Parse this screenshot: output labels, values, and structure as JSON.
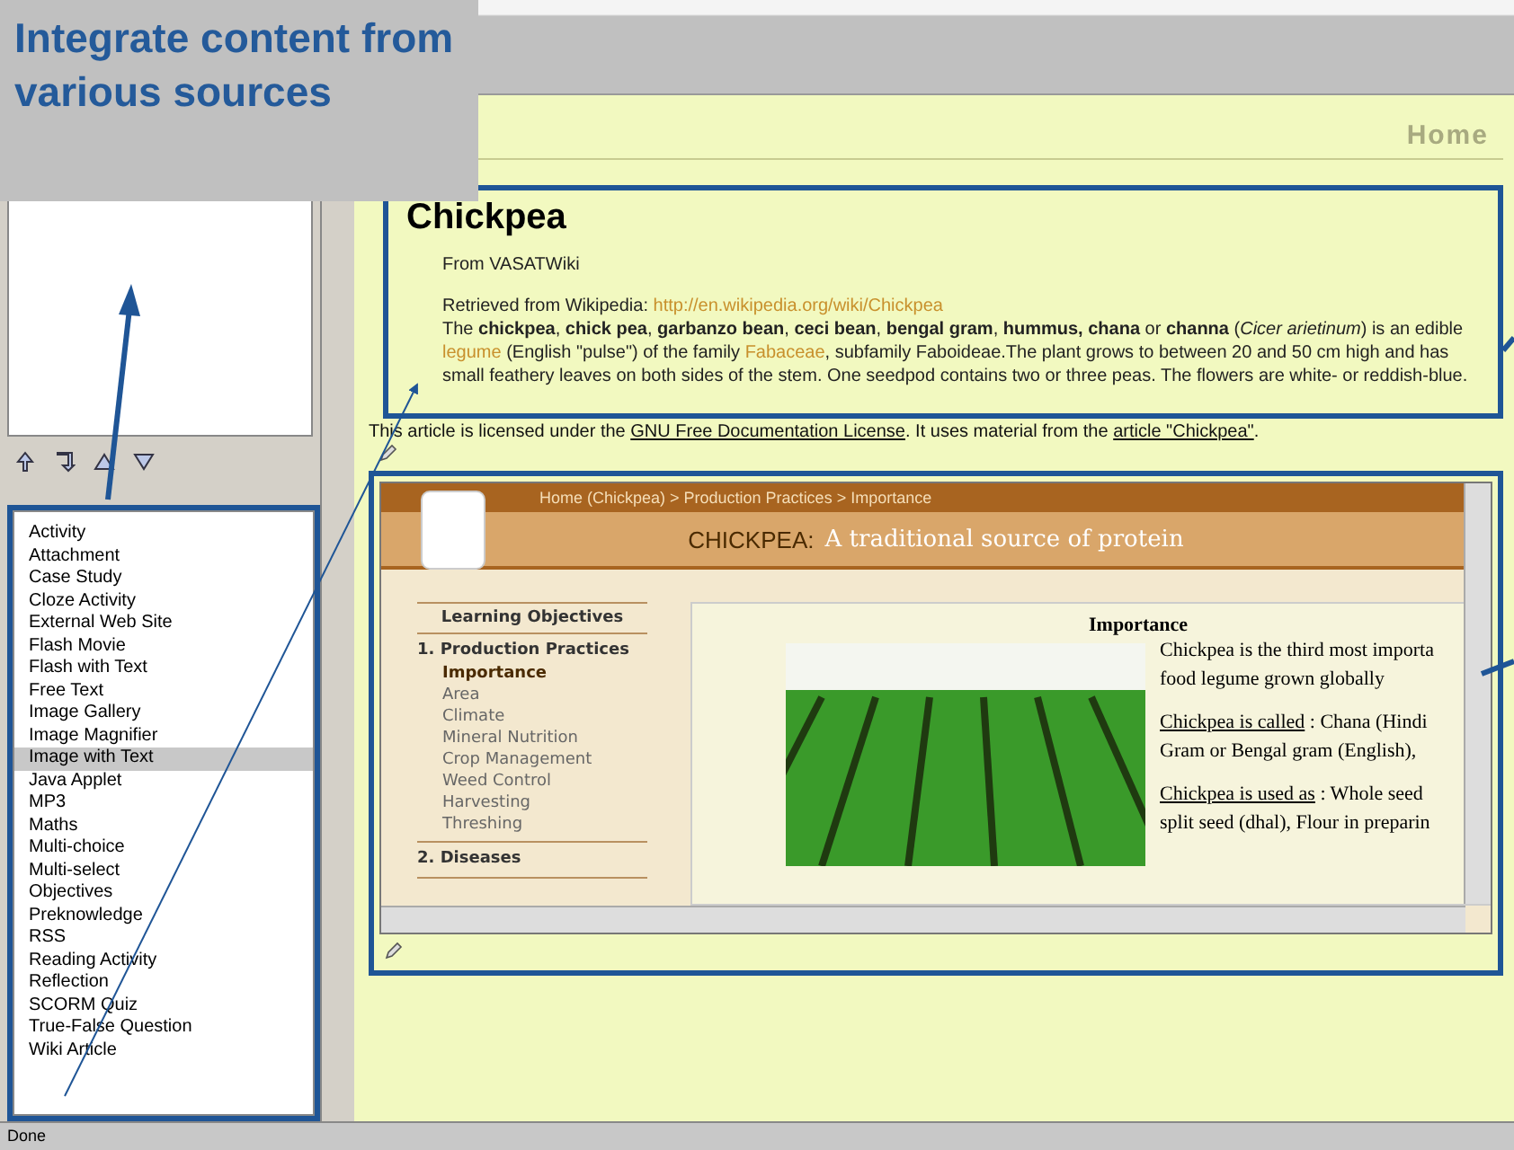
{
  "callout": {
    "text": "Integrate content from various sources"
  },
  "sidebar": {
    "idevices": [
      {
        "label": "Activity",
        "selected": false
      },
      {
        "label": "Attachment",
        "selected": false
      },
      {
        "label": "Case Study",
        "selected": false
      },
      {
        "label": "Cloze Activity",
        "selected": false
      },
      {
        "label": "External Web Site",
        "selected": false
      },
      {
        "label": "Flash Movie",
        "selected": false
      },
      {
        "label": "Flash with Text",
        "selected": false
      },
      {
        "label": "Free Text",
        "selected": false
      },
      {
        "label": "Image Gallery",
        "selected": false
      },
      {
        "label": "Image Magnifier",
        "selected": false
      },
      {
        "label": "Image with Text",
        "selected": true
      },
      {
        "label": "Java Applet",
        "selected": false
      },
      {
        "label": "MP3",
        "selected": false
      },
      {
        "label": "Maths",
        "selected": false
      },
      {
        "label": "Multi-choice",
        "selected": false
      },
      {
        "label": "Multi-select",
        "selected": false
      },
      {
        "label": "Objectives",
        "selected": false
      },
      {
        "label": "Preknowledge",
        "selected": false
      },
      {
        "label": "RSS",
        "selected": false
      },
      {
        "label": "Reading Activity",
        "selected": false
      },
      {
        "label": "Reflection",
        "selected": false
      },
      {
        "label": "SCORM Quiz",
        "selected": false
      },
      {
        "label": "True-False Question",
        "selected": false
      },
      {
        "label": "Wiki Article",
        "selected": false
      }
    ]
  },
  "page": {
    "heading": "Home",
    "article": {
      "title": "Chickpea",
      "source": "From VASATWiki",
      "retrieved_label": "Retrieved from Wikipedia:",
      "retrieved_url": "http://en.wikipedia.org/wiki/Chickpea",
      "body": [
        {
          "kind": "text",
          "text": "The **chickpea**, **chick pea**, **garbanzo bean**, **ceci bean**, **bengal gram**, **hummus, chana** or **channa** (*Cicer arietinum*) is an edible "
        },
        {
          "kind": "link",
          "text": "legume"
        },
        {
          "kind": "text",
          "text": " (English \"pulse\") of the family "
        },
        {
          "kind": "link",
          "text": "Fabaceae"
        },
        {
          "kind": "text",
          "text": ", subfamily Faboideae.The plant grows to between 20 and 50 cm high and has small feathery leaves on both sides of the stem. One seedpod contains two or three peas. The flowers are white- or reddish-blue."
        }
      ]
    },
    "license": [
      {
        "kind": "text",
        "text": "This article is licensed under the "
      },
      {
        "kind": "link",
        "text": "GNU Free Documentation License"
      },
      {
        "kind": "text",
        "text": ". It uses material from the "
      },
      {
        "kind": "link",
        "text": "article \"Chickpea\""
      },
      {
        "kind": "text",
        "text": "."
      }
    ],
    "embedded": {
      "breadcrumb": "Home (Chickpea) > Production Practices > Importance",
      "title_prefix": "CHICKPEA:",
      "title_suffix": "A traditional source of protein",
      "nav": {
        "header": "Learning Objectives",
        "sections": [
          {
            "label": "1. Production Practices",
            "items": [
              {
                "label": "Importance",
                "selected": true
              },
              {
                "label": "Area",
                "selected": false
              },
              {
                "label": "Climate",
                "selected": false
              },
              {
                "label": "Mineral Nutrition",
                "selected": false
              },
              {
                "label": "Crop Management",
                "selected": false
              },
              {
                "label": "Weed Control",
                "selected": false
              },
              {
                "label": "Harvesting",
                "selected": false
              },
              {
                "label": "Threshing",
                "selected": false
              }
            ]
          },
          {
            "label": "2. Diseases"
          }
        ]
      },
      "content": {
        "heading": "Importance",
        "paragraphs": [
          {
            "lines": [
              "Chickpea is the third most importa",
              "food legume grown globally"
            ]
          },
          {
            "term": "Chickpea is called",
            "lines": [
              " : Chana (Hindi",
              "Gram or Bengal gram (English),"
            ]
          },
          {
            "term": "Chickpea is used as",
            "lines": [
              " : Whole seed",
              "split seed (dhal), Flour in preparin"
            ]
          }
        ]
      }
    }
  },
  "status_bar": {
    "text": "Done"
  }
}
